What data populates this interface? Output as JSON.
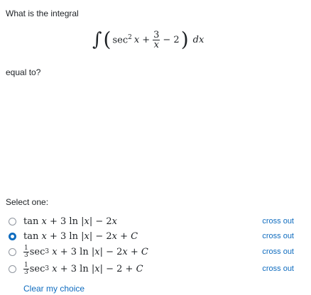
{
  "question": {
    "prompt": "What is the integral",
    "suffix": "equal to?",
    "integral": {
      "integral_sign": "∫",
      "lparen": "(",
      "rparen": ")",
      "sec": "sec",
      "sup2": "2",
      "x": "x",
      "plus": "+",
      "frac_num": "3",
      "frac_den": "x",
      "minus_two": "− 2",
      "dx": "dx"
    }
  },
  "select_label": "Select one:",
  "options": [
    {
      "selected": false,
      "cross_label": "cross out",
      "parts": {
        "a": "tan",
        "b": "x",
        "c": "+ 3 ln |",
        "d": "x",
        "e": "| − 2",
        "f": "x"
      }
    },
    {
      "selected": true,
      "cross_label": "cross out",
      "parts": {
        "a": "tan",
        "b": "x",
        "c": "+ 3 ln |",
        "d": "x",
        "e": "| − 2",
        "f": "x",
        "g": "+",
        "h": "C"
      }
    },
    {
      "selected": false,
      "cross_label": "cross out",
      "parts": {
        "fn": "1",
        "fd": "3",
        "a": "sec",
        "s": "3",
        "b": "x",
        "c": "+ 3 ln |",
        "d": "x",
        "e": "| − 2",
        "f": "x",
        "g": "+",
        "h": "C"
      }
    },
    {
      "selected": false,
      "cross_label": "cross out",
      "parts": {
        "fn": "1",
        "fd": "3",
        "a": "sec",
        "s": "3",
        "b": "x",
        "c": "+ 3 ln |",
        "d": "x",
        "e": "| − 2 +",
        "h": "C"
      }
    }
  ],
  "clear_label": "Clear my choice",
  "colors": {
    "link": "#0f6cbf",
    "text": "#1d2125",
    "radio_border": "#8f959e"
  }
}
